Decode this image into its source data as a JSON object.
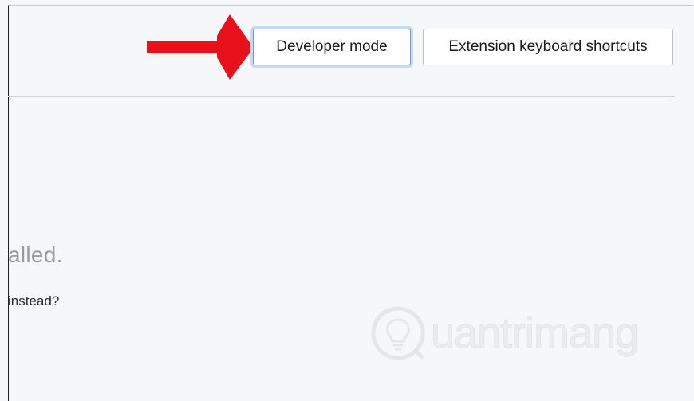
{
  "header": {
    "developer_mode_label": "Developer mode",
    "shortcuts_label": "Extension keyboard shortcuts"
  },
  "empty_state": {
    "heading": "alled.",
    "subtext": "instead?"
  },
  "watermark": {
    "text": "uantrimang"
  },
  "annotation": {
    "arrow_color": "#e8101a"
  }
}
